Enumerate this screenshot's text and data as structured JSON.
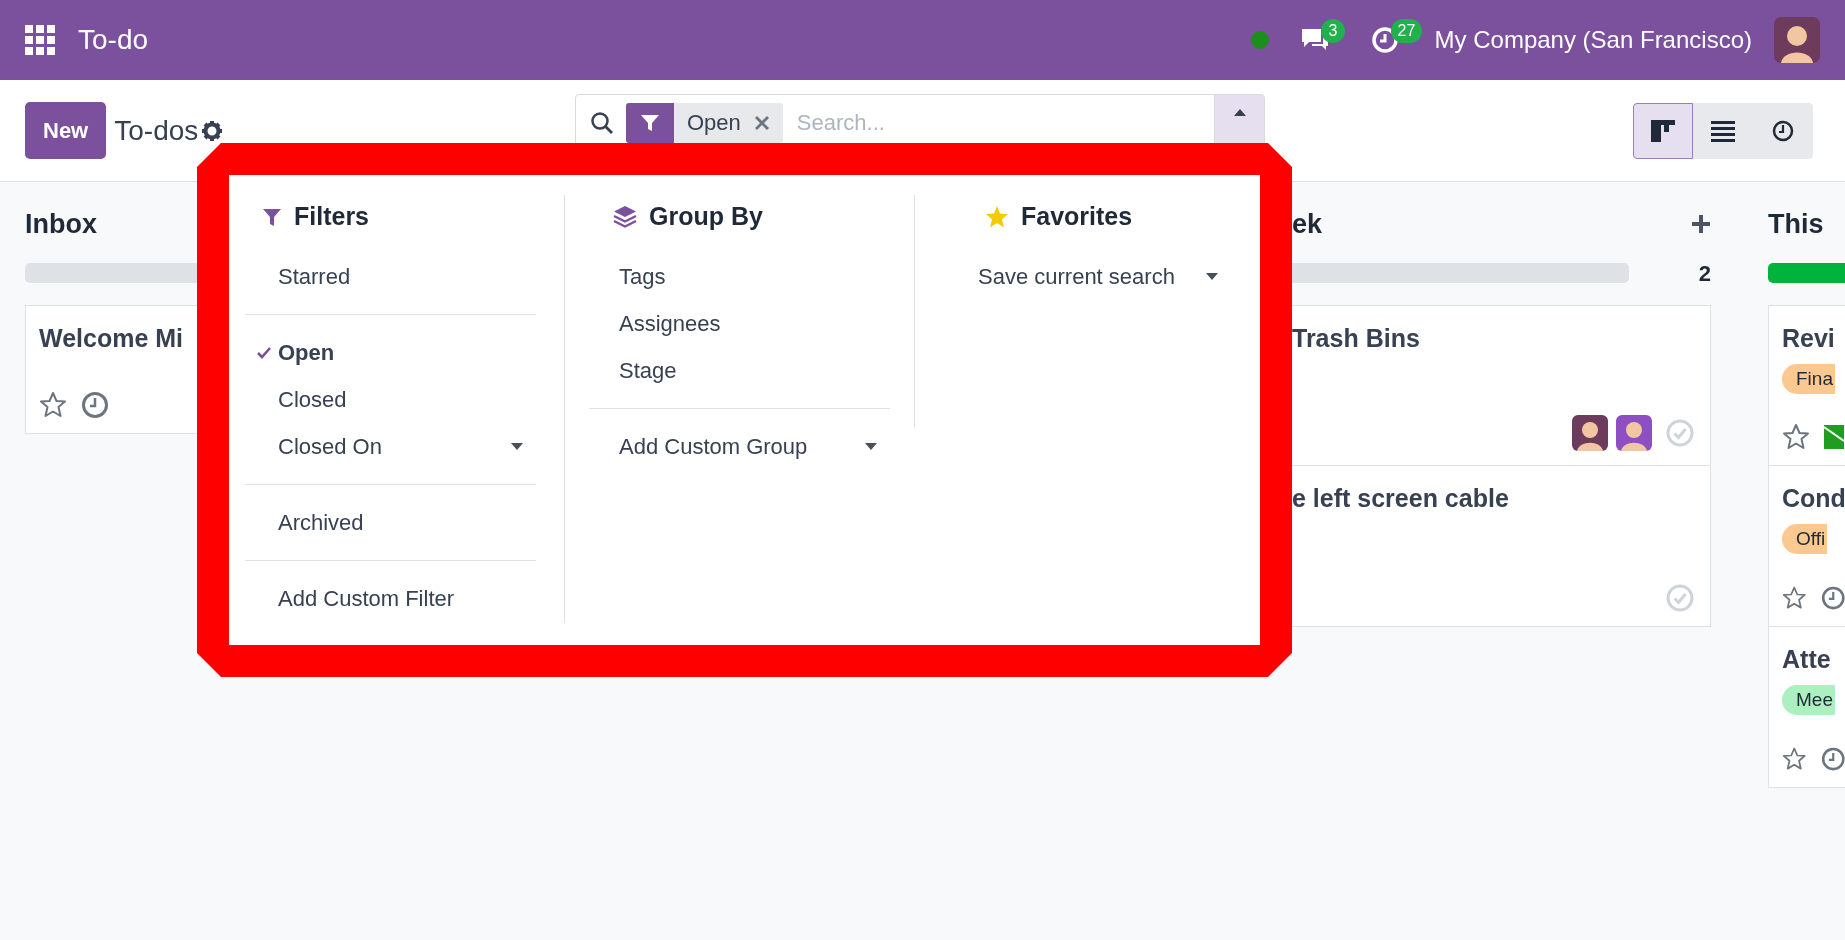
{
  "navbar": {
    "app_title": "To-do",
    "online": true,
    "messages_count": "3",
    "activities_count": "27",
    "company": "My Company (San Francisco)"
  },
  "control_panel": {
    "new_button": "New",
    "breadcrumb": "To-dos",
    "search": {
      "facets": [
        {
          "label": "Open"
        }
      ],
      "placeholder": "Search...",
      "panel_open": true
    },
    "views": [
      {
        "kind": "kanban",
        "selected": true
      },
      {
        "kind": "list",
        "selected": false
      },
      {
        "kind": "activity",
        "selected": false
      }
    ]
  },
  "search_panel": {
    "filters": {
      "title": "Filters",
      "groups": [
        [
          {
            "label": "Starred",
            "checked": false,
            "kind": "option"
          }
        ],
        [
          {
            "label": "Open",
            "checked": true,
            "kind": "option"
          },
          {
            "label": "Closed",
            "checked": false,
            "kind": "option"
          },
          {
            "label": "Closed On",
            "checked": false,
            "kind": "dropdown"
          }
        ],
        [
          {
            "label": "Archived",
            "checked": false,
            "kind": "option"
          }
        ],
        [
          {
            "label": "Add Custom Filter",
            "checked": false,
            "kind": "option"
          }
        ]
      ]
    },
    "group_by": {
      "title": "Group By",
      "groups": [
        [
          {
            "label": "Tags",
            "kind": "option"
          },
          {
            "label": "Assignees",
            "kind": "option"
          },
          {
            "label": "Stage",
            "kind": "option"
          }
        ],
        [
          {
            "label": "Add Custom Group",
            "kind": "dropdown"
          }
        ]
      ]
    },
    "favorites": {
      "title": "Favorites",
      "items": [
        {
          "label": "Save current search",
          "kind": "dropdown"
        }
      ]
    }
  },
  "kanban": {
    "columns": [
      {
        "title": "Inbox",
        "level": 0,
        "cards": [
          {
            "title": "Welcome Mi",
            "kind": "star_clock"
          }
        ]
      },
      {
        "title": "ek",
        "count": "2",
        "level": 0,
        "add": true,
        "cards": [
          {
            "title": "Trash Bins",
            "kind": "avatars_check"
          },
          {
            "title": "e left screen cable",
            "kind": "check"
          }
        ]
      },
      {
        "title": "This",
        "level": 1,
        "cards": [
          {
            "title": "Revi",
            "tag": {
              "label": "Fina",
              "color": "#fbc98f"
            },
            "kind": "star_mail"
          },
          {
            "title": "Cond",
            "tag": {
              "label": "Offi",
              "color": "#fbc98f"
            },
            "kind": "star_clock"
          },
          {
            "title": "Atte",
            "tag": {
              "label": "Mee",
              "color": "#adf0c0"
            },
            "kind": "star_clock"
          }
        ]
      }
    ]
  }
}
